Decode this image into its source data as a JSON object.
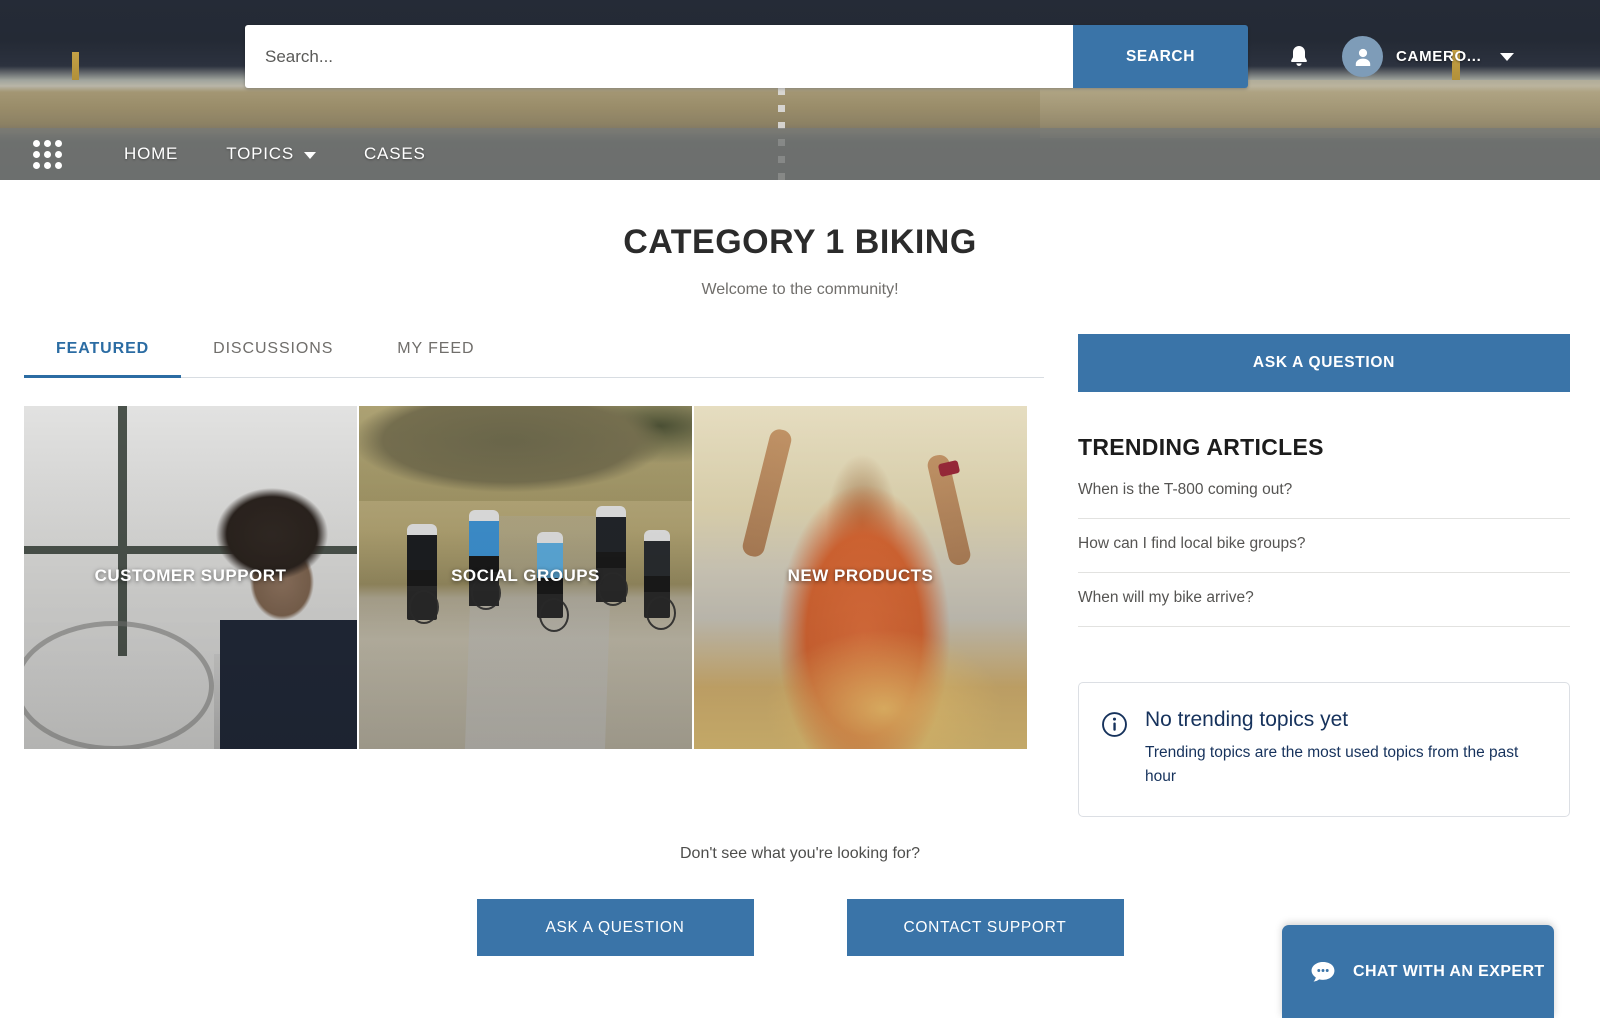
{
  "header": {
    "search": {
      "placeholder": "Search...",
      "value": "",
      "button_label": "SEARCH"
    },
    "notifications_icon": "bell-icon",
    "user": {
      "name": "CAMERO...",
      "avatar_icon": "user-avatar-icon",
      "caret_icon": "chevron-down-icon"
    }
  },
  "nav": {
    "app_launcher_icon": "waffle-grid-icon",
    "items": [
      {
        "label": "HOME",
        "has_dropdown": false
      },
      {
        "label": "TOPICS",
        "has_dropdown": true
      },
      {
        "label": "CASES",
        "has_dropdown": false
      }
    ]
  },
  "page": {
    "title": "CATEGORY 1 BIKING",
    "subtitle": "Welcome to the community!"
  },
  "tabs": [
    {
      "label": "FEATURED",
      "active": true
    },
    {
      "label": "DISCUSSIONS",
      "active": false
    },
    {
      "label": "MY FEED",
      "active": false
    }
  ],
  "featured_cards": [
    {
      "label": "CUSTOMER SUPPORT",
      "art": "office-support-photo"
    },
    {
      "label": "SOCIAL GROUPS",
      "art": "cyclists-road-photo"
    },
    {
      "label": "NEW PRODUCTS",
      "art": "woman-arms-raised-photo"
    }
  ],
  "sidebar": {
    "ask_button_label": "ASK A QUESTION",
    "trending_heading": "TRENDING ARTICLES",
    "articles": [
      "When is the T-800 coming out?",
      "How can I find local bike groups?",
      "When will my bike arrive?"
    ],
    "info_box": {
      "icon": "info-circle-icon",
      "title": "No trending topics yet",
      "body": "Trending topics are the most used topics from the past hour"
    }
  },
  "cta": {
    "text": "Don't see what you're looking for?",
    "ask_label": "ASK A QUESTION",
    "contact_label": "CONTACT SUPPORT"
  },
  "chat": {
    "icon": "chat-bubble-icon",
    "label": "CHAT WITH AN EXPERT"
  },
  "colors": {
    "accent_blue": "#3a74a8",
    "tab_active": "#2b6ca3",
    "info_text": "#16325c",
    "nav_overlay": "rgba(120,122,120,0.82)"
  }
}
